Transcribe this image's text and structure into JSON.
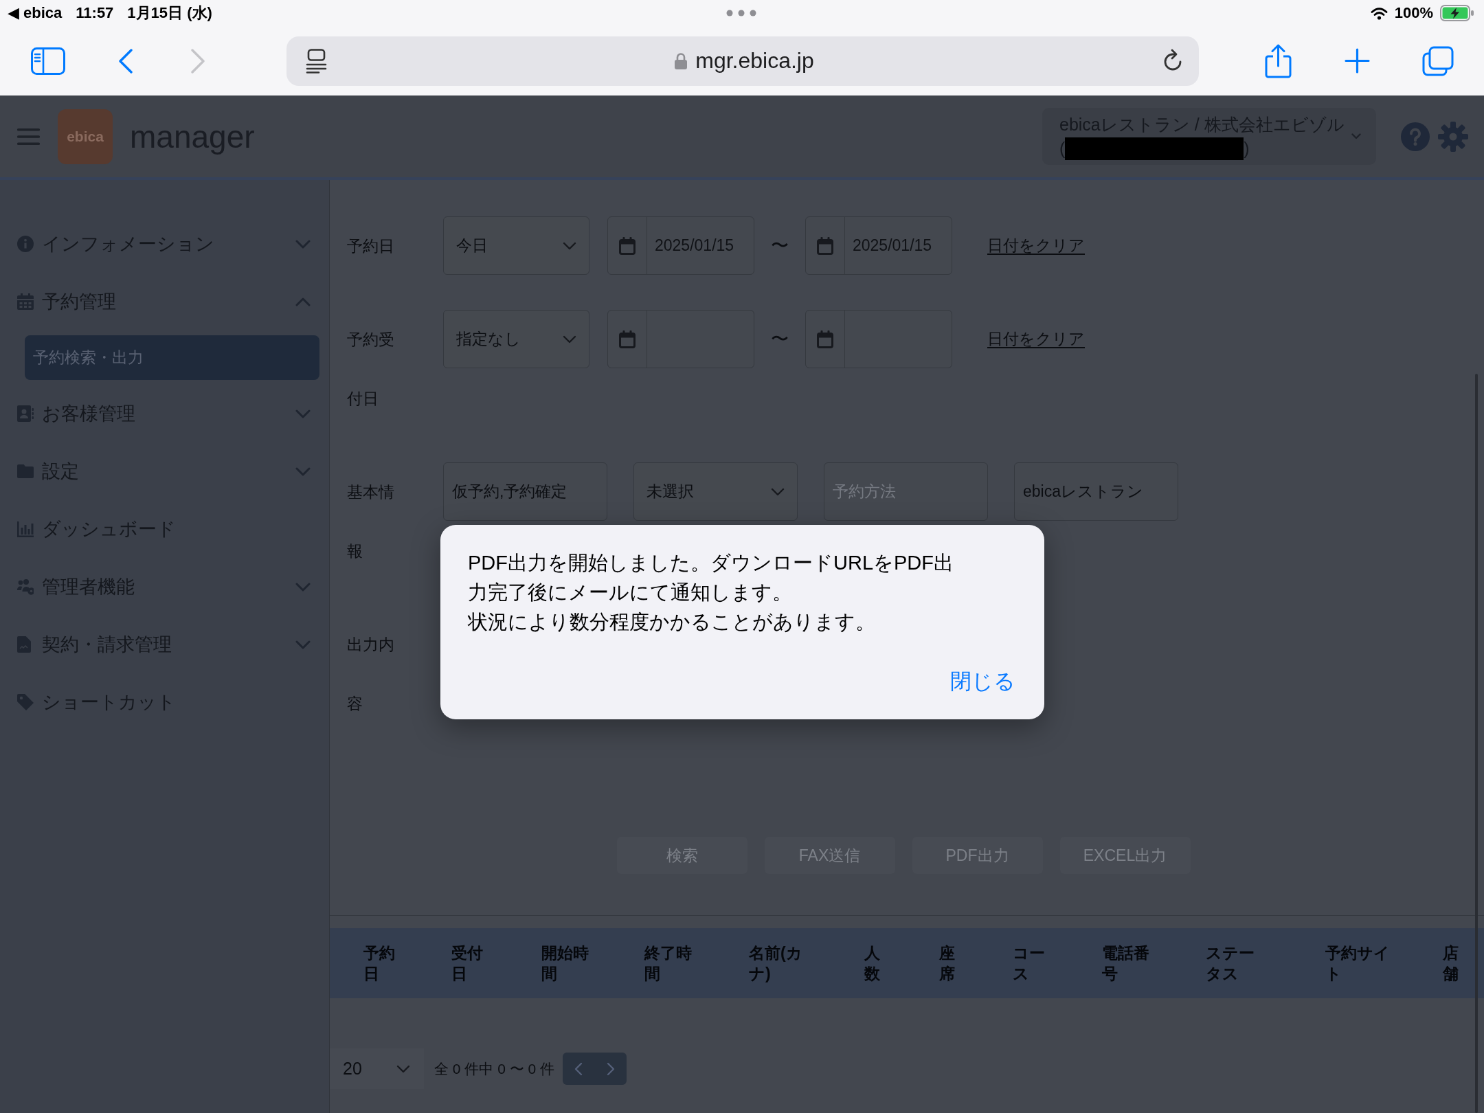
{
  "status_bar": {
    "back_link": "◀ ebica",
    "time": "11:57",
    "date": "1月15日 (水)",
    "battery_percent": "100%"
  },
  "browser_toolbar": {
    "back": {
      "disabled": false
    },
    "forward": {
      "disabled": true
    },
    "url": "mgr.ebica.jp"
  },
  "app_header": {
    "logo": "ebica",
    "title": "manager",
    "account": {
      "name": "ebicaレストラン / 株式会社エビゾル",
      "detail_open": "(",
      "detail_close": ")"
    }
  },
  "sidebar": {
    "items": [
      {
        "kind": "group",
        "label": "インフォメーション",
        "expanded": false
      },
      {
        "kind": "group",
        "label": "予約管理",
        "expanded": true,
        "children": [
          {
            "label": "予約検索・出力",
            "selected": true
          }
        ]
      },
      {
        "kind": "group",
        "label": "お客様管理",
        "expanded": false
      },
      {
        "kind": "group",
        "label": "設定",
        "expanded": false
      },
      {
        "kind": "link",
        "label": "ダッシュボード"
      },
      {
        "kind": "group",
        "label": "管理者機能",
        "expanded": false
      },
      {
        "kind": "group",
        "label": "契約・請求管理",
        "expanded": false
      },
      {
        "kind": "link",
        "label": "ショートカット"
      }
    ]
  },
  "search_form": {
    "rows": [
      {
        "kind": "date_range",
        "label": "予約日",
        "preset": "今日",
        "from": "2025/01/15",
        "separator": "〜",
        "to": "2025/01/15",
        "clear_link": "日付をクリア"
      },
      {
        "kind": "date_range",
        "label": "予約受付日",
        "preset": "指定なし",
        "separator": "〜",
        "clear_link": "日付をクリア"
      },
      {
        "kind": "fields",
        "label": "基本情報",
        "fields": [
          {
            "kind": "text",
            "value": "仮予約,予約確定"
          },
          {
            "kind": "select",
            "value": "未選択"
          },
          {
            "kind": "text",
            "placeholder": "予約方法"
          },
          {
            "kind": "text",
            "value": "ebicaレストラン"
          }
        ]
      },
      {
        "label": "出力内容"
      }
    ],
    "buttons": [
      "検索",
      "FAX送信",
      "PDF出力",
      "EXCEL出力"
    ]
  },
  "results_table": {
    "columns": [
      "予約日",
      "受付日",
      "開始時間",
      "終了時間",
      "名前(カナ)",
      "人数",
      "座席",
      "コース",
      "電話番号",
      "ステータス",
      "予約サイト",
      "店舗"
    ]
  },
  "pagination": {
    "page_size": "20",
    "summary": "全 0 件中 0 〜 0 件"
  },
  "dialog": {
    "message": [
      "PDF出力を開始しました。ダウンロードURLをPDF出力完了後にメールにて通知します。",
      "状況により数分程度かかることがあります。"
    ],
    "button": "閉じる"
  }
}
